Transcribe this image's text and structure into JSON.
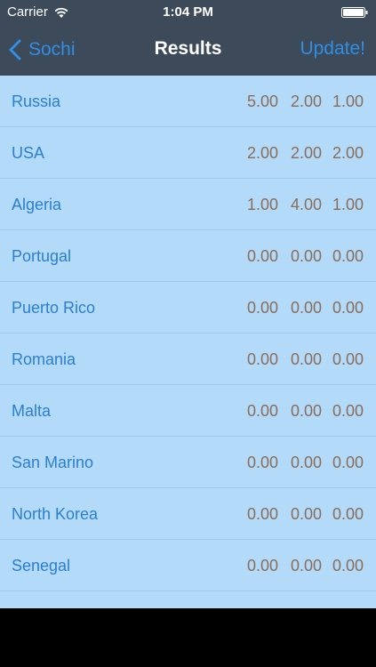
{
  "status_bar": {
    "carrier": "Carrier",
    "time": "1:04 PM"
  },
  "nav": {
    "back_label": "Sochi",
    "title": "Results",
    "update_label": "Update!"
  },
  "results": [
    {
      "country": "Russia",
      "v1": "5.00",
      "v2": "2.00",
      "v3": "1.00"
    },
    {
      "country": "USA",
      "v1": "2.00",
      "v2": "2.00",
      "v3": "2.00"
    },
    {
      "country": "Algeria",
      "v1": "1.00",
      "v2": "4.00",
      "v3": "1.00"
    },
    {
      "country": "Portugal",
      "v1": "0.00",
      "v2": "0.00",
      "v3": "0.00"
    },
    {
      "country": "Puerto Rico",
      "v1": "0.00",
      "v2": "0.00",
      "v3": "0.00"
    },
    {
      "country": "Romania",
      "v1": "0.00",
      "v2": "0.00",
      "v3": "0.00"
    },
    {
      "country": "Malta",
      "v1": "0.00",
      "v2": "0.00",
      "v3": "0.00"
    },
    {
      "country": "San Marino",
      "v1": "0.00",
      "v2": "0.00",
      "v3": "0.00"
    },
    {
      "country": "North Korea",
      "v1": "0.00",
      "v2": "0.00",
      "v3": "0.00"
    },
    {
      "country": "Senegal",
      "v1": "0.00",
      "v2": "0.00",
      "v3": "0.00"
    },
    {
      "country": "",
      "v1": "",
      "v2": "",
      "v3": ""
    }
  ],
  "colors": {
    "nav_background": "#3d4a5a",
    "accent": "#2f8ee6",
    "list_background": "#b3daf8",
    "country_text": "#2a7fd0",
    "value_text": "#8a6d5a"
  },
  "icons": {
    "wifi": "wifi-icon",
    "battery": "battery-icon",
    "back": "chevron-left-icon"
  }
}
